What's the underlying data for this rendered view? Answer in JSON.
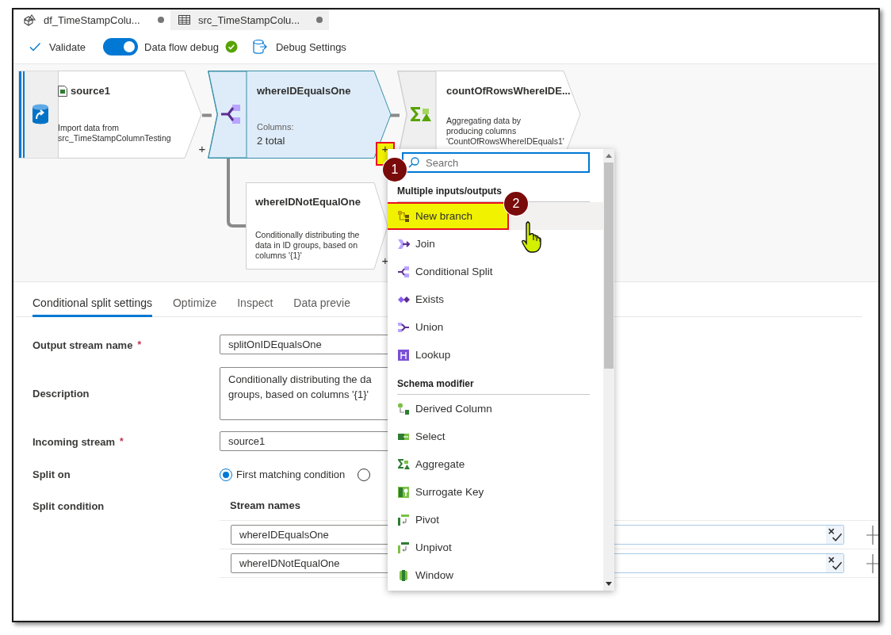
{
  "tabs": [
    {
      "label": "df_TimeStampColu...",
      "kind": "dataflow",
      "selected": true,
      "unsaved": true
    },
    {
      "label": "src_TimeStampColu...",
      "kind": "dataset",
      "selected": false,
      "unsaved": true
    }
  ],
  "toolbar": {
    "validate": "Validate",
    "debug_toggle": {
      "label": "Data flow debug",
      "on": true,
      "ready": true
    },
    "debug_settings": "Debug Settings"
  },
  "canvas": {
    "nodes": [
      {
        "kind": "source",
        "title": "source1",
        "selected": false,
        "description_lines": [
          "Import data from",
          "src_TimeStampColumnTesting"
        ],
        "plus": "+",
        "plus_highlighted": false
      },
      {
        "kind": "split",
        "title": "whereIDEqualsOne",
        "selected": true,
        "columns_label": "Columns:",
        "columns_value": "2 total",
        "plus": "+",
        "plus_highlighted": true
      },
      {
        "kind": "aggregate",
        "title": "countOfRowsWhereIDE...",
        "selected": false,
        "description_lines": [
          "Aggregating data by",
          "producing columns",
          "'CountOfRowsWhereIDEquals1'"
        ]
      },
      {
        "kind": "branch",
        "title": "whereIDNotEqualOne",
        "selected": false,
        "description_lines": [
          "Conditionally distributing the",
          "data in ID groups, based on",
          "columns '{1}'"
        ],
        "plus": "+",
        "plus_highlighted": false
      }
    ]
  },
  "menu": {
    "search_placeholder": "Search",
    "sections": [
      {
        "title": "Multiple inputs/outputs",
        "items": [
          {
            "label": "New branch",
            "highlighted": true
          },
          {
            "label": "Join",
            "highlighted": false
          },
          {
            "label": "Conditional Split",
            "highlighted": false
          },
          {
            "label": "Exists",
            "highlighted": false
          },
          {
            "label": "Union",
            "highlighted": false
          },
          {
            "label": "Lookup",
            "highlighted": false
          }
        ]
      },
      {
        "title": "Schema modifier",
        "items": [
          {
            "label": "Derived Column",
            "highlighted": false
          },
          {
            "label": "Select",
            "highlighted": false
          },
          {
            "label": "Aggregate",
            "highlighted": false
          },
          {
            "label": "Surrogate Key",
            "highlighted": false
          },
          {
            "label": "Pivot",
            "highlighted": false
          },
          {
            "label": "Unpivot",
            "highlighted": false
          },
          {
            "label": "Window",
            "highlighted": false
          }
        ]
      }
    ]
  },
  "callouts": [
    {
      "label": "1"
    },
    {
      "label": "2"
    }
  ],
  "settings": {
    "tabs": [
      {
        "label": "Conditional split settings",
        "selected": true
      },
      {
        "label": "Optimize",
        "selected": false
      },
      {
        "label": "Inspect",
        "selected": false
      },
      {
        "label": "Data previe",
        "selected": false
      }
    ],
    "output_stream_name": {
      "label": "Output stream name",
      "required_mark": "*",
      "value": "splitOnIDEqualsOne"
    },
    "description": {
      "label": "Description",
      "value_lines": [
        "Conditionally distributing the da",
        "groups, based on columns '{1}'"
      ]
    },
    "incoming_stream": {
      "label": "Incoming stream",
      "required_mark": "*",
      "value": "source1"
    },
    "split_on": {
      "label": "Split on",
      "options": [
        {
          "label": "First matching condition",
          "selected": true
        },
        {
          "selected": false
        }
      ]
    },
    "split_condition": {
      "label": "Split condition",
      "column": "Stream names",
      "rows": [
        {
          "stream": "whereIDEqualsOne"
        },
        {
          "stream": "whereIDNotEqualOne"
        }
      ]
    }
  }
}
